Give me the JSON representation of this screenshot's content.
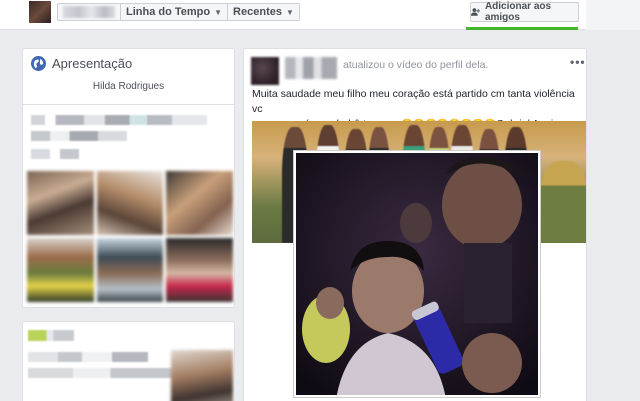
{
  "nav": {
    "timeline_label": "Linha do Tempo",
    "recent_label": "Recentes",
    "add_friend_label": "Adicionar aos amigos"
  },
  "intro": {
    "title": "Apresentação",
    "name": "Hilda Rodrigues"
  },
  "post": {
    "action_text": "atualizou o vídeo do perfil dela.",
    "text_line1": "Muita saudade meu filho meu coração está partido cm tanta violência vc",
    "text_line2_start": "sempre será meu bebê te amor",
    "emojis": "😭😭😭😭😭😭😭😭",
    "text_line2_end": "Gabriel Aguiar",
    "menu": "•••"
  },
  "colors": {
    "facebook_blue": "#4267b2",
    "green_accent": "#42b72a",
    "page_bg": "#e9ebee"
  },
  "icons": {
    "add_friend": "add-friend-icon",
    "globe": "globe-icon",
    "menu": "more-options-icon"
  }
}
